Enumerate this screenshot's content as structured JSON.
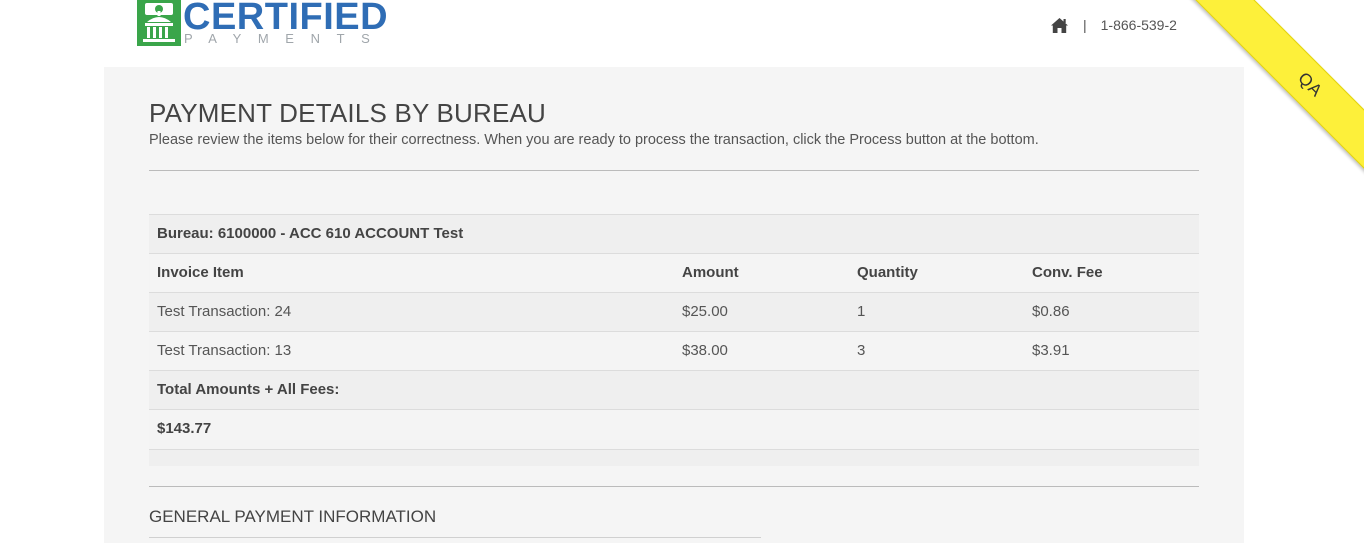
{
  "header": {
    "logo_word": "CERTIFIED",
    "logo_sub": "PAYMENTS",
    "home_icon": "home-icon",
    "separator": "|",
    "phone": "1-866-539-2"
  },
  "ribbon": {
    "label": "QA",
    "color": "#fdf03a"
  },
  "page": {
    "title": "PAYMENT DETAILS BY BUREAU",
    "subtitle": "Please review the items below for their correctness. When you are ready to process the transaction, click the Process button at the bottom."
  },
  "bureau_table": {
    "bureau_label": "Bureau: 6100000 - ACC 610 ACCOUNT Test",
    "columns": [
      "Invoice Item",
      "Amount",
      "Quantity",
      "Conv. Fee"
    ],
    "rows": [
      {
        "item": "Test Transaction: 24",
        "amount": "$25.00",
        "quantity": "1",
        "fee": "$0.86"
      },
      {
        "item": "Test Transaction: 13",
        "amount": "$38.00",
        "quantity": "3",
        "fee": "$3.91"
      }
    ],
    "total_label": "Total Amounts + All Fees:",
    "total_value": "$143.77"
  },
  "general_section": {
    "title": "GENERAL PAYMENT INFORMATION"
  },
  "colors": {
    "brand_blue": "#2f6db5",
    "brand_green": "#3aa54a",
    "panel_bg": "#f5f5f5"
  }
}
